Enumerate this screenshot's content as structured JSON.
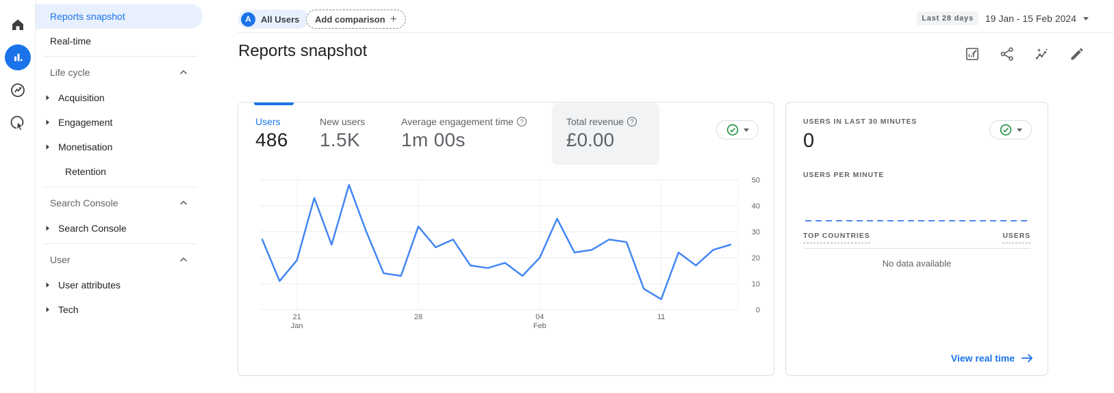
{
  "colors": {
    "accent": "#1a73e8",
    "chart_line": "#4285f4",
    "check_green": "#1e8e3e",
    "selected_bg": "#e8f0fe"
  },
  "rail": {
    "icons": [
      "home",
      "reports",
      "explore",
      "advertising"
    ]
  },
  "sidebar": {
    "items": [
      {
        "label": "Reports snapshot",
        "selected": true
      },
      {
        "label": "Real-time"
      },
      {
        "label": "Life cycle",
        "type": "header"
      },
      {
        "label": "Acquisition"
      },
      {
        "label": "Engagement"
      },
      {
        "label": "Monetisation"
      },
      {
        "label": "Retention"
      },
      {
        "label": "Search Console",
        "type": "header"
      },
      {
        "label": "Search Console"
      },
      {
        "label": "User",
        "type": "header"
      },
      {
        "label": "User attributes"
      },
      {
        "label": "Tech"
      }
    ]
  },
  "topbar": {
    "avatar_letter": "A",
    "all_users": "All Users",
    "add_comparison": "Add comparison",
    "plus": "+",
    "last_28_days": "Last 28 days",
    "date_range": "19 Jan - 15 Feb 2024"
  },
  "header": {
    "title": "Reports snapshot",
    "icons": [
      "customize-report",
      "share",
      "insights",
      "edit"
    ]
  },
  "metrics": [
    {
      "label": "Users",
      "value": "486",
      "selected": true
    },
    {
      "label": "New users",
      "value": "1.5K"
    },
    {
      "label": "Average engagement time",
      "value": "1m 00s",
      "help": true
    },
    {
      "label": "Total revenue",
      "value": "£0.00",
      "help": true,
      "highlighted": true
    }
  ],
  "chart_data": {
    "type": "line",
    "series": [
      {
        "name": "Users",
        "values": [
          27,
          11,
          19,
          43,
          25,
          48,
          30,
          14,
          13,
          32,
          24,
          27,
          17,
          16,
          18,
          13,
          20,
          35,
          22,
          23,
          27,
          26,
          8,
          4,
          22,
          17,
          23,
          25
        ]
      }
    ],
    "x_start": "19 Jan 2024",
    "x_end": "15 Feb 2024",
    "x_ticks": [
      {
        "index": 2,
        "label": "21",
        "sublabel": "Jan"
      },
      {
        "index": 9,
        "label": "28",
        "sublabel": ""
      },
      {
        "index": 16,
        "label": "04",
        "sublabel": "Feb"
      },
      {
        "index": 23,
        "label": "11",
        "sublabel": ""
      }
    ],
    "y_ticks": [
      0,
      10,
      20,
      30,
      40,
      50
    ],
    "ylim": [
      0,
      50
    ],
    "grid": true,
    "line_color": "#4285f4",
    "legend_position": "none"
  },
  "realtime": {
    "title": "USERS IN LAST 30 MINUTES",
    "value": "0",
    "per_minute_label": "USERS PER MINUTE",
    "countries_header": "TOP COUNTRIES",
    "users_header": "USERS",
    "empty_message": "No data available",
    "link_label": "View real time"
  }
}
